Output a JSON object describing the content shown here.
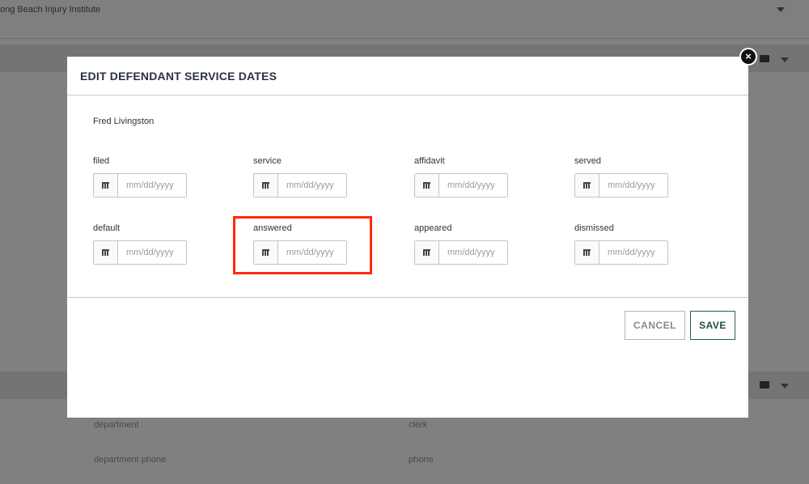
{
  "background": {
    "company": "ong Beach Injury Institute",
    "labels": [
      "department",
      "clerk",
      "department phone",
      "phone"
    ]
  },
  "modal": {
    "title": "EDIT DEFENDANT SERVICE DATES",
    "close_icon": "×",
    "party_name": "Fred Livingston",
    "fields": [
      {
        "label": "filed",
        "placeholder": "mm/dd/yyyy"
      },
      {
        "label": "service",
        "placeholder": "mm/dd/yyyy"
      },
      {
        "label": "affidavit",
        "placeholder": "mm/dd/yyyy"
      },
      {
        "label": "served",
        "placeholder": "mm/dd/yyyy"
      },
      {
        "label": "default",
        "placeholder": "mm/dd/yyyy"
      },
      {
        "label": "answered",
        "placeholder": "mm/dd/yyyy"
      },
      {
        "label": "appeared",
        "placeholder": "mm/dd/yyyy"
      },
      {
        "label": "dismissed",
        "placeholder": "mm/dd/yyyy"
      }
    ],
    "cancel_label": "CANCEL",
    "save_label": "SAVE"
  },
  "colors": {
    "highlight": "#ff2a0a",
    "save_text": "#1e4d44"
  }
}
